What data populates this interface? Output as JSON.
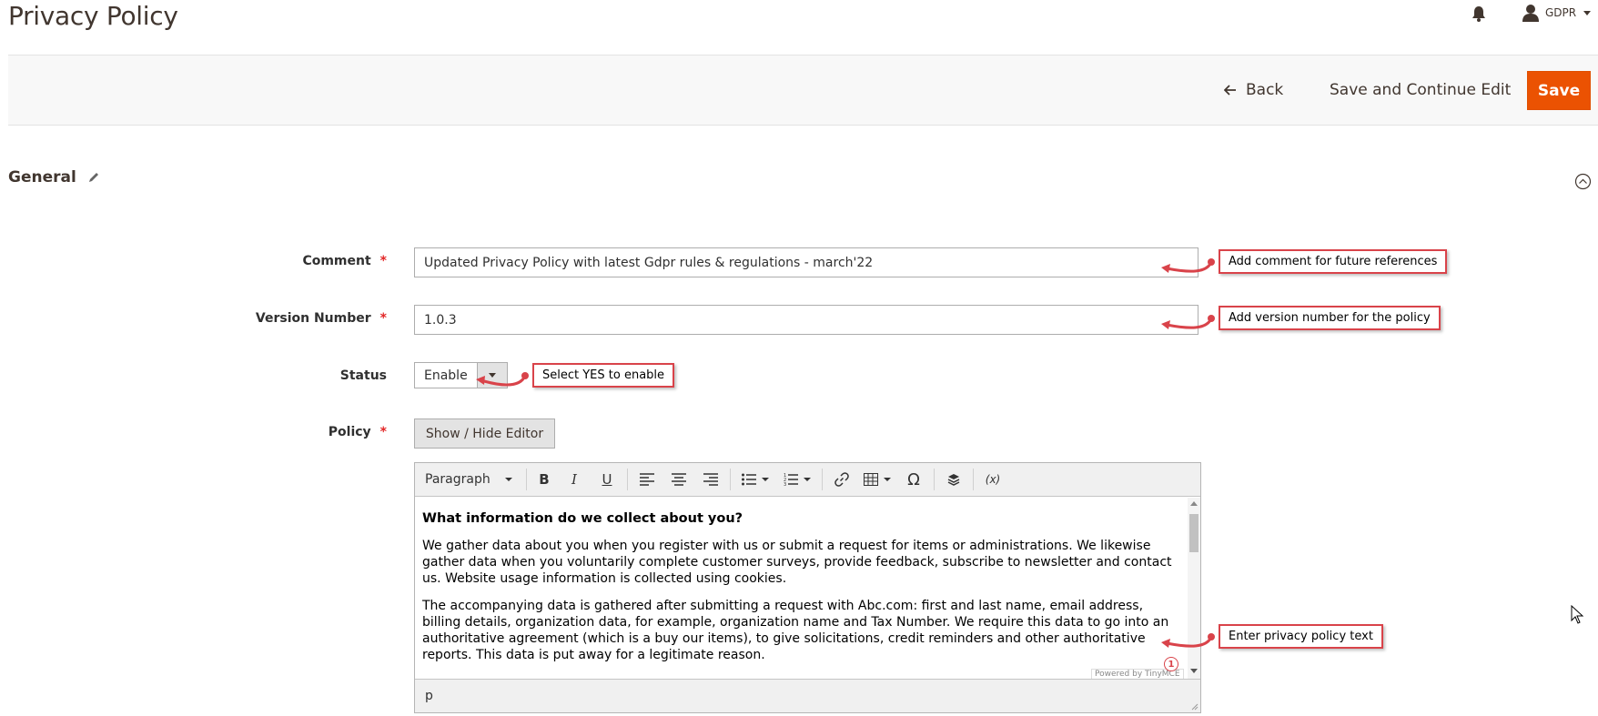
{
  "header": {
    "title": "Privacy Policy",
    "user_name": "GDPR"
  },
  "actions": {
    "back_label": "Back",
    "save_continue_label": "Save and Continue Edit",
    "save_label": "Save"
  },
  "section": {
    "title": "General"
  },
  "form": {
    "comment_label": "Comment",
    "comment_value": "Updated Privacy Policy with latest Gdpr rules & regulations - march'22",
    "version_label": "Version Number",
    "version_value": "1.0.3",
    "status_label": "Status",
    "status_value": "Enable",
    "policy_label": "Policy",
    "toggle_editor_label": "Show / Hide Editor"
  },
  "editor": {
    "format_select": "Paragraph",
    "heading": "What information do we collect about you?",
    "paragraph1": "We gather data about you when you register with us or submit a request for items or administrations. We likewise gather data when you voluntarily complete customer surveys, provide feedback, subscribe to newsletter and contact us. Website usage information is collected using cookies.",
    "paragraph2": " The accompanying data is gathered after submitting a request with Abc.com: first and last name, email address, billing details, organization data, for example, organization name and Tax Number. We require this data to go into an authoritative agreement (which is a buy our items), to give solicitations, credit reminders and other authoritative reports. This data is put away for a legitimate reason.",
    "powered_by": "Powered by TinyMCE",
    "status_path": "p",
    "badge_count": "1"
  },
  "callouts": {
    "comment": "Add comment for future references",
    "version": "Add version number for the policy",
    "status": "Select YES to enable",
    "policy": "Enter privacy policy text"
  },
  "colors": {
    "accent": "#eb5202",
    "callout_border": "#d9434a",
    "required": "#e22626"
  }
}
